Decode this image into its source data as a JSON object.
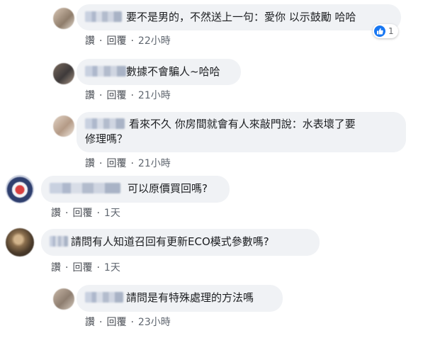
{
  "actions": {
    "like": "讚",
    "reply": "回覆"
  },
  "comments": [
    {
      "text": "要不是男的，不然送上一句：愛你 以示鼓勵 哈哈",
      "time": "22小時",
      "reaction_count": "1"
    },
    {
      "text": "數據不會騙人~哈哈",
      "time": "21小時"
    },
    {
      "text_line1": "看來不久 你房間就會有人來敲門說：水表壞了要",
      "text_line2": "修理嗎？",
      "time": "21小時"
    },
    {
      "text": "可以原價買回嗎?",
      "time": "1天"
    },
    {
      "text": "請問有人知道召回有更新ECO模式參數嗎?",
      "time": "1天"
    },
    {
      "text": "請問是有特殊處理的方法嗎",
      "time": "23小時"
    }
  ],
  "colors": {
    "bubble": "#f0f2f5",
    "text": "#1c1e21",
    "meta": "#4b4f56",
    "like": "#1877f2"
  }
}
